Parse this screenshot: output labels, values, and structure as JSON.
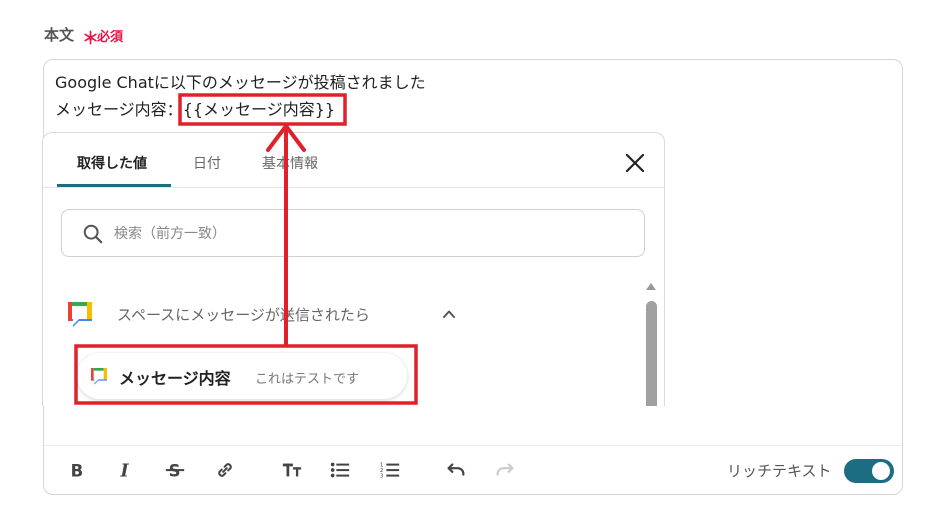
{
  "field": {
    "label": "本文",
    "required_mark": "＊",
    "required_text": "必須"
  },
  "editor": {
    "line1": "Google Chatに以下のメッセージが投稿されました",
    "line2_prefix": "メッセージ内容：",
    "line2_variable": "{{メッセージ内容}}"
  },
  "panel": {
    "tabs": [
      {
        "label": "取得した値",
        "active": true
      },
      {
        "label": "日付",
        "active": false
      },
      {
        "label": "基本情報",
        "active": false
      }
    ],
    "search": {
      "placeholder": "検索（前方一致）"
    },
    "group": {
      "title": "スペースにメッセージが送信されたら",
      "icon": "google-chat-icon",
      "expanded": true
    },
    "item": {
      "label": "メッセージ内容",
      "value": "これはテストです",
      "icon": "google-chat-icon"
    }
  },
  "toolbar": {
    "icons": [
      "bold-icon",
      "italic-icon",
      "strikethrough-icon",
      "link-icon",
      "text-size-icon",
      "bullet-list-icon",
      "numbered-list-icon",
      "undo-icon",
      "redo-icon"
    ],
    "rich_text_label": "リッチテキスト",
    "rich_text_enabled": true
  },
  "colors": {
    "accent": "#1d6d82",
    "required": "#ee1144",
    "annotation": "#e0202a"
  }
}
